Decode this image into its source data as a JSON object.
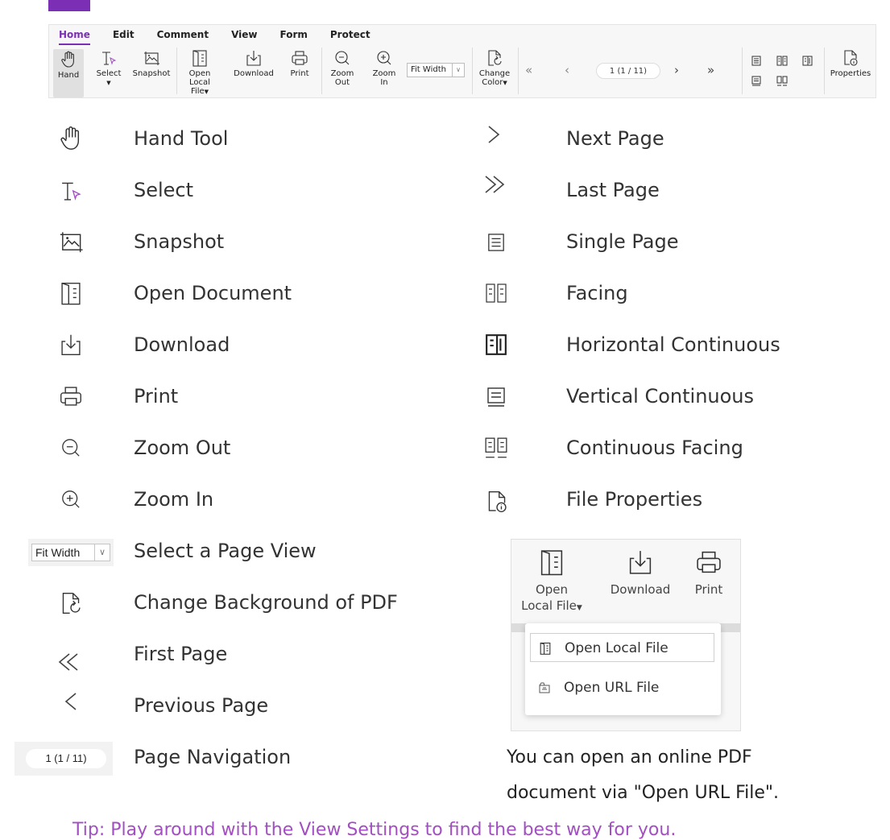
{
  "toolbar": {
    "tabs": [
      "Home",
      "Edit",
      "Comment",
      "View",
      "Form",
      "Protect"
    ],
    "buttons": {
      "hand": "Hand",
      "select": "Select",
      "snapshot": "Snapshot",
      "open_l1": "Open",
      "open_l2": "Local File",
      "download": "Download",
      "print": "Print",
      "zoom_out_l1": "Zoom",
      "zoom_out_l2": "Out",
      "zoom_in_l1": "Zoom",
      "zoom_in_l2": "In",
      "fit_width": "Fit Width",
      "change_l1": "Change",
      "change_l2": "Color",
      "page_indicator": "1 (1 / 11)",
      "properties": "Properties"
    }
  },
  "legend": {
    "left": [
      {
        "icon": "hand-icon",
        "label": "Hand Tool"
      },
      {
        "icon": "select-icon",
        "label": "Select"
      },
      {
        "icon": "snapshot-icon",
        "label": "Snapshot"
      },
      {
        "icon": "open-document-icon",
        "label": "Open Document"
      },
      {
        "icon": "download-icon",
        "label": "Download"
      },
      {
        "icon": "print-icon",
        "label": "Print"
      },
      {
        "icon": "zoom-out-icon",
        "label": "Zoom Out"
      },
      {
        "icon": "zoom-in-icon",
        "label": "Zoom In"
      },
      {
        "icon": "page-view-select",
        "label": "Select a Page View",
        "control": "Fit Width"
      },
      {
        "icon": "change-background-icon",
        "label": "Change Background of PDF"
      },
      {
        "icon": "first-page-icon",
        "label": "First Page"
      },
      {
        "icon": "previous-page-icon",
        "label": "Previous Page"
      },
      {
        "icon": "page-navigation-field",
        "label": "Page Navigation",
        "control": "1 (1 / 11)"
      }
    ],
    "right": [
      {
        "icon": "next-page-icon",
        "label": "Next Page"
      },
      {
        "icon": "last-page-icon",
        "label": "Last Page"
      },
      {
        "icon": "single-page-icon",
        "label": "Single Page"
      },
      {
        "icon": "facing-icon",
        "label": "Facing"
      },
      {
        "icon": "horizontal-continuous-icon",
        "label": "Horizontal Continuous"
      },
      {
        "icon": "vertical-continuous-icon",
        "label": "Vertical Continuous"
      },
      {
        "icon": "continuous-facing-icon",
        "label": "Continuous Facing"
      },
      {
        "icon": "file-properties-icon",
        "label": "File Properties"
      }
    ]
  },
  "inset": {
    "open_l1": "Open",
    "open_l2": "Local File",
    "download": "Download",
    "print": "Print",
    "menu": [
      "Open Local File",
      "Open URL File"
    ]
  },
  "caption": "You can open an online PDF document via \"Open URL File\".",
  "tip": "Tip: Play around with the View Settings to find the best way for you."
}
